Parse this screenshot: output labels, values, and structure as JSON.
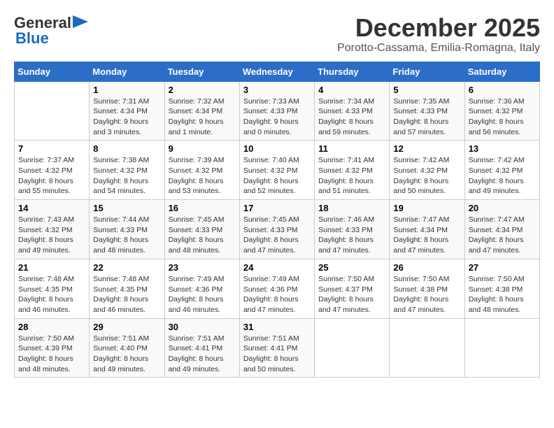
{
  "logo": {
    "general": "General",
    "blue": "Blue"
  },
  "title": {
    "month": "December 2025",
    "location": "Porotto-Cassama, Emilia-Romagna, Italy"
  },
  "columns": [
    "Sunday",
    "Monday",
    "Tuesday",
    "Wednesday",
    "Thursday",
    "Friday",
    "Saturday"
  ],
  "weeks": [
    [
      {
        "day": "",
        "sunrise": "",
        "sunset": "",
        "daylight": ""
      },
      {
        "day": "1",
        "sunrise": "Sunrise: 7:31 AM",
        "sunset": "Sunset: 4:34 PM",
        "daylight": "Daylight: 9 hours and 3 minutes."
      },
      {
        "day": "2",
        "sunrise": "Sunrise: 7:32 AM",
        "sunset": "Sunset: 4:34 PM",
        "daylight": "Daylight: 9 hours and 1 minute."
      },
      {
        "day": "3",
        "sunrise": "Sunrise: 7:33 AM",
        "sunset": "Sunset: 4:33 PM",
        "daylight": "Daylight: 9 hours and 0 minutes."
      },
      {
        "day": "4",
        "sunrise": "Sunrise: 7:34 AM",
        "sunset": "Sunset: 4:33 PM",
        "daylight": "Daylight: 8 hours and 59 minutes."
      },
      {
        "day": "5",
        "sunrise": "Sunrise: 7:35 AM",
        "sunset": "Sunset: 4:33 PM",
        "daylight": "Daylight: 8 hours and 57 minutes."
      },
      {
        "day": "6",
        "sunrise": "Sunrise: 7:36 AM",
        "sunset": "Sunset: 4:32 PM",
        "daylight": "Daylight: 8 hours and 56 minutes."
      }
    ],
    [
      {
        "day": "7",
        "sunrise": "Sunrise: 7:37 AM",
        "sunset": "Sunset: 4:32 PM",
        "daylight": "Daylight: 8 hours and 55 minutes."
      },
      {
        "day": "8",
        "sunrise": "Sunrise: 7:38 AM",
        "sunset": "Sunset: 4:32 PM",
        "daylight": "Daylight: 8 hours and 54 minutes."
      },
      {
        "day": "9",
        "sunrise": "Sunrise: 7:39 AM",
        "sunset": "Sunset: 4:32 PM",
        "daylight": "Daylight: 8 hours and 53 minutes."
      },
      {
        "day": "10",
        "sunrise": "Sunrise: 7:40 AM",
        "sunset": "Sunset: 4:32 PM",
        "daylight": "Daylight: 8 hours and 52 minutes."
      },
      {
        "day": "11",
        "sunrise": "Sunrise: 7:41 AM",
        "sunset": "Sunset: 4:32 PM",
        "daylight": "Daylight: 8 hours and 51 minutes."
      },
      {
        "day": "12",
        "sunrise": "Sunrise: 7:42 AM",
        "sunset": "Sunset: 4:32 PM",
        "daylight": "Daylight: 8 hours and 50 minutes."
      },
      {
        "day": "13",
        "sunrise": "Sunrise: 7:42 AM",
        "sunset": "Sunset: 4:32 PM",
        "daylight": "Daylight: 8 hours and 49 minutes."
      }
    ],
    [
      {
        "day": "14",
        "sunrise": "Sunrise: 7:43 AM",
        "sunset": "Sunset: 4:32 PM",
        "daylight": "Daylight: 8 hours and 49 minutes."
      },
      {
        "day": "15",
        "sunrise": "Sunrise: 7:44 AM",
        "sunset": "Sunset: 4:33 PM",
        "daylight": "Daylight: 8 hours and 48 minutes."
      },
      {
        "day": "16",
        "sunrise": "Sunrise: 7:45 AM",
        "sunset": "Sunset: 4:33 PM",
        "daylight": "Daylight: 8 hours and 48 minutes."
      },
      {
        "day": "17",
        "sunrise": "Sunrise: 7:45 AM",
        "sunset": "Sunset: 4:33 PM",
        "daylight": "Daylight: 8 hours and 47 minutes."
      },
      {
        "day": "18",
        "sunrise": "Sunrise: 7:46 AM",
        "sunset": "Sunset: 4:33 PM",
        "daylight": "Daylight: 8 hours and 47 minutes."
      },
      {
        "day": "19",
        "sunrise": "Sunrise: 7:47 AM",
        "sunset": "Sunset: 4:34 PM",
        "daylight": "Daylight: 8 hours and 47 minutes."
      },
      {
        "day": "20",
        "sunrise": "Sunrise: 7:47 AM",
        "sunset": "Sunset: 4:34 PM",
        "daylight": "Daylight: 8 hours and 47 minutes."
      }
    ],
    [
      {
        "day": "21",
        "sunrise": "Sunrise: 7:48 AM",
        "sunset": "Sunset: 4:35 PM",
        "daylight": "Daylight: 8 hours and 46 minutes."
      },
      {
        "day": "22",
        "sunrise": "Sunrise: 7:48 AM",
        "sunset": "Sunset: 4:35 PM",
        "daylight": "Daylight: 8 hours and 46 minutes."
      },
      {
        "day": "23",
        "sunrise": "Sunrise: 7:49 AM",
        "sunset": "Sunset: 4:36 PM",
        "daylight": "Daylight: 8 hours and 46 minutes."
      },
      {
        "day": "24",
        "sunrise": "Sunrise: 7:49 AM",
        "sunset": "Sunset: 4:36 PM",
        "daylight": "Daylight: 8 hours and 47 minutes."
      },
      {
        "day": "25",
        "sunrise": "Sunrise: 7:50 AM",
        "sunset": "Sunset: 4:37 PM",
        "daylight": "Daylight: 8 hours and 47 minutes."
      },
      {
        "day": "26",
        "sunrise": "Sunrise: 7:50 AM",
        "sunset": "Sunset: 4:38 PM",
        "daylight": "Daylight: 8 hours and 47 minutes."
      },
      {
        "day": "27",
        "sunrise": "Sunrise: 7:50 AM",
        "sunset": "Sunset: 4:38 PM",
        "daylight": "Daylight: 8 hours and 48 minutes."
      }
    ],
    [
      {
        "day": "28",
        "sunrise": "Sunrise: 7:50 AM",
        "sunset": "Sunset: 4:39 PM",
        "daylight": "Daylight: 8 hours and 48 minutes."
      },
      {
        "day": "29",
        "sunrise": "Sunrise: 7:51 AM",
        "sunset": "Sunset: 4:40 PM",
        "daylight": "Daylight: 8 hours and 49 minutes."
      },
      {
        "day": "30",
        "sunrise": "Sunrise: 7:51 AM",
        "sunset": "Sunset: 4:41 PM",
        "daylight": "Daylight: 8 hours and 49 minutes."
      },
      {
        "day": "31",
        "sunrise": "Sunrise: 7:51 AM",
        "sunset": "Sunset: 4:41 PM",
        "daylight": "Daylight: 8 hours and 50 minutes."
      },
      {
        "day": "",
        "sunrise": "",
        "sunset": "",
        "daylight": ""
      },
      {
        "day": "",
        "sunrise": "",
        "sunset": "",
        "daylight": ""
      },
      {
        "day": "",
        "sunrise": "",
        "sunset": "",
        "daylight": ""
      }
    ]
  ]
}
